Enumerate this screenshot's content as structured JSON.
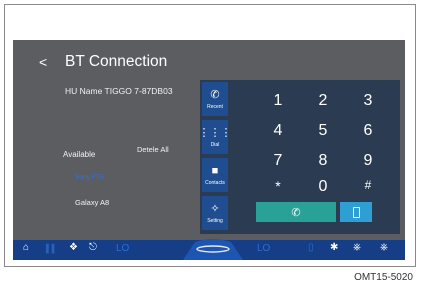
{
  "header": {
    "back_symbol": "<",
    "title": "BT Connection"
  },
  "left": {
    "hu_name": "HU Name TIGGO 7-87DB03",
    "available_label": "Available",
    "delete_all_label": "Detele All",
    "devices": [
      "Sony FTS",
      "Galaxy A8"
    ]
  },
  "side_menu": [
    {
      "label": "Recent",
      "icon": "recent-call-icon"
    },
    {
      "label": "Dial",
      "icon": "dialpad-icon"
    },
    {
      "label": "Contacts",
      "icon": "contacts-icon"
    },
    {
      "label": "Setting",
      "icon": "bluetooth-setting-icon"
    }
  ],
  "keypad": [
    "1",
    "2",
    "3",
    "4",
    "5",
    "6",
    "7",
    "8",
    "9",
    "*",
    "0",
    "#"
  ],
  "bottom_bar": {
    "left_temp": "LO",
    "right_temp": "LO"
  },
  "caption": "OMT15-5020",
  "colors": {
    "screen_bg": "#5b5d60",
    "panel_bg": "#2b3c52",
    "side_button": "#1f4d8f",
    "call_button": "#2aa196",
    "phone_button": "#2f9ed3",
    "bottom_bar": "#163e86"
  }
}
